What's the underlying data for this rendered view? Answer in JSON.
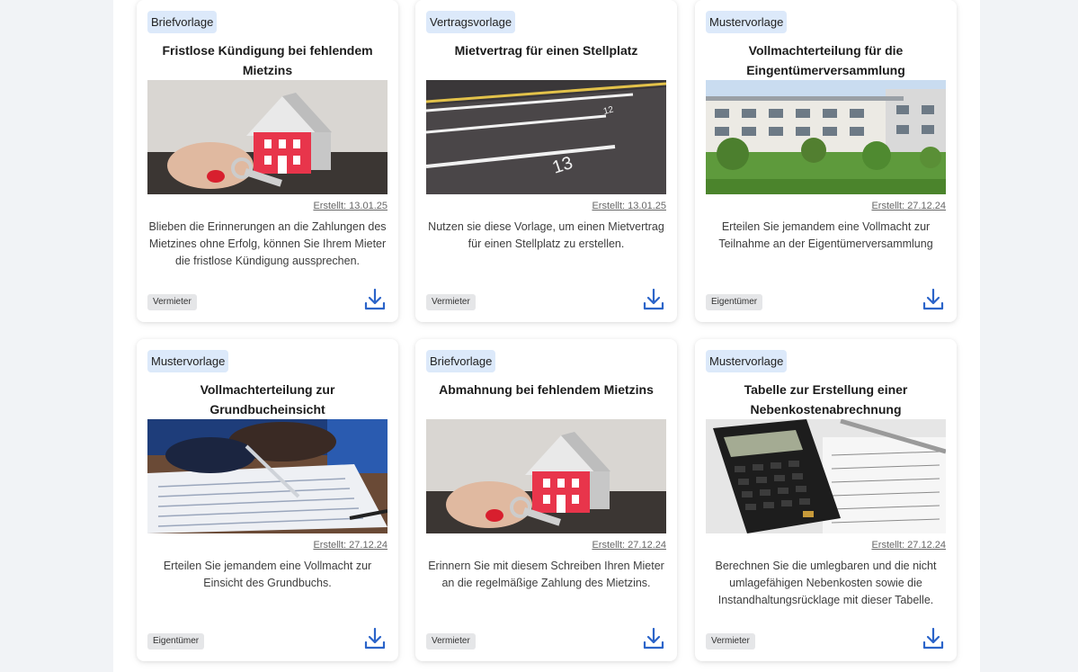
{
  "cards": [
    {
      "badge": "Briefvorlage",
      "title": "Fristlose Kündigung bei fehlendem Mietzins",
      "image": "house-with-keys",
      "created": "Erstellt: 13.01.25",
      "description": "Blieben die Erinnerungen an die Zahlungen des Mietzines ohne Erfolg, können Sie Ihrem Mieter die fristlose Kündigung aussprechen.",
      "tag": "Vermieter",
      "download_icon": "download-icon"
    },
    {
      "badge": "Vertragsvorlage",
      "title": "Mietvertrag für einen Stellplatz",
      "image": "parking-lot",
      "created": "Erstellt: 13.01.25",
      "description": "Nutzen sie diese Vorlage, um einen Mietvertrag für einen Stellplatz zu erstellen.",
      "tag": "Vermieter",
      "download_icon": "download-icon"
    },
    {
      "badge": "Mustervorlage",
      "title": "Vollmachterteilung für die Eingentümerversammlung",
      "image": "apartment-building",
      "created": "Erstellt: 27.12.24",
      "description": "Erteilen Sie jemandem eine Vollmacht zur Teilnahme an der Eigentümerversammlung",
      "tag": "Eigentümer",
      "download_icon": "download-icon"
    },
    {
      "badge": "Mustervorlage",
      "title": "Vollmachterteilung zur Grundbucheinsicht",
      "image": "signing-document",
      "created": "Erstellt: 27.12.24",
      "description": "Erteilen Sie jemandem eine Vollmacht zur Einsicht des Grundbuchs.",
      "tag": "Eigentümer",
      "download_icon": "download-icon"
    },
    {
      "badge": "Briefvorlage",
      "title": "Abmahnung bei fehlendem Mietzins",
      "image": "house-with-keys",
      "created": "Erstellt: 27.12.24",
      "description": "Erinnern Sie mit diesem Schreiben Ihren Mieter an die regelmäßige Zahlung des Mietzins.",
      "tag": "Vermieter",
      "download_icon": "download-icon"
    },
    {
      "badge": "Mustervorlage",
      "title": "Tabelle zur Erstellung einer Nebenkostenabrechnung",
      "image": "calculator",
      "created": "Erstellt: 27.12.24",
      "description": "Berechnen Sie die umlegbaren und die nicht umlagefähigen Nebenkosten sowie die Instandhaltungsrücklage mit dieser Tabelle.",
      "tag": "Vermieter",
      "download_icon": "download-icon"
    }
  ],
  "colors": {
    "badge_background": "#dce9fa",
    "download_icon": "#2b64c9",
    "tag_background": "#e5e6e8"
  }
}
